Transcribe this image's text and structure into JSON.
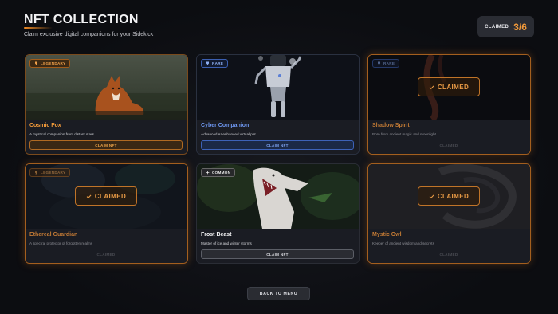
{
  "header": {
    "title": "NFT COLLECTION",
    "subtitle": "Claim exclusive digital companions for your Sidekick"
  },
  "counter": {
    "label": "CLAIMED",
    "value": "3/6"
  },
  "cards": [
    {
      "badge": "LEGENDARY",
      "name": "Cosmic Fox",
      "desc": "A mystical companion from distant stars",
      "button": "CLAIM NFT",
      "claimed": false
    },
    {
      "badge": "RARE",
      "name": "Cyber Companion",
      "desc": "Advanced AI-enhanced virtual pet",
      "button": "CLAIM NFT",
      "claimed": false
    },
    {
      "badge": "RARE",
      "name": "Shadow Spirit",
      "desc": "Born from ancient magic and moonlight",
      "button": "CLAIMED",
      "claimed": true,
      "stamp": "CLAIMED"
    },
    {
      "badge": "LEGENDARY",
      "name": "Ethereal Guardian",
      "desc": "A spectral protector of forgotten realms",
      "button": "CLAIMED",
      "claimed": true,
      "stamp": "CLAIMED"
    },
    {
      "badge": "COMMON",
      "name": "Frost Beast",
      "desc": "Master of ice and winter storms",
      "button": "CLAIM NFT",
      "claimed": false
    },
    {
      "badge": "",
      "name": "Mystic Owl",
      "desc": "Keeper of ancient wisdom and secrets",
      "button": "CLAIMED",
      "claimed": true,
      "stamp": "CLAIMED"
    }
  ],
  "footer": {
    "back_label": "BACK TO MENU"
  },
  "colors": {
    "accent": "#f08a24",
    "rare": "#5c86e0",
    "background": "#0c0d11"
  }
}
